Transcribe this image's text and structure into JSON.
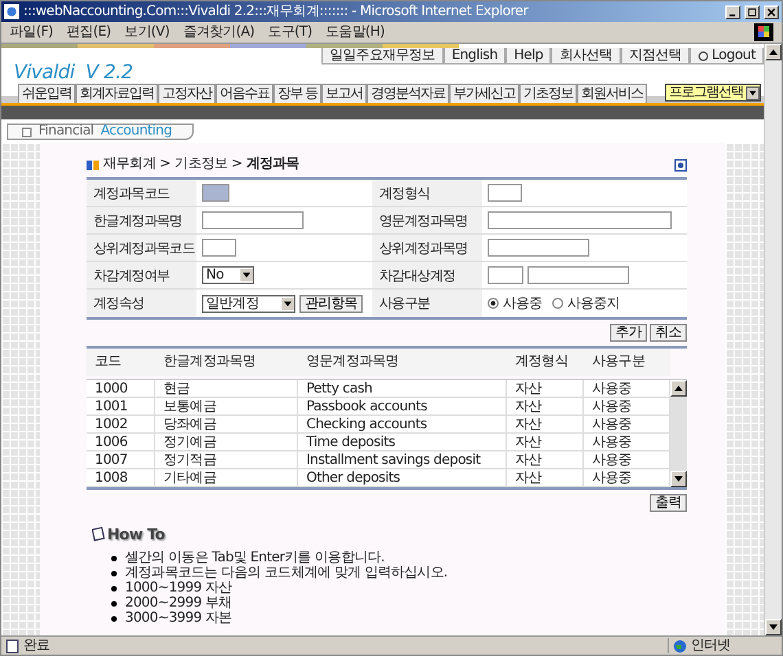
{
  "window": {
    "title": ":::webNaccounting.Com:::Vivaldi 2.2:::재무회계::::::: - Microsoft Internet Explorer"
  },
  "menu": [
    "파일(F)",
    "편집(E)",
    "보기(V)",
    "즐겨찾기(A)",
    "도구(T)",
    "도움말(H)"
  ],
  "top_links": [
    "일일주요재무정보",
    "English",
    "Help",
    "회사선택",
    "지점선택",
    "Logout"
  ],
  "logo": "Vivaldi  V 2.2",
  "nav_tabs": [
    "쉬운입력",
    "회계자료입력",
    "고정자산",
    "어음수표",
    "장부 등",
    "보고서",
    "경영분석자료",
    "부가세신고",
    "기초정보",
    "회원서비스"
  ],
  "program_select": "프로그램선택",
  "section_tab": {
    "word_1": "Financial",
    "word_2": "Accounting"
  },
  "breadcrumb": [
    "재무회계 >",
    "기초정보 >",
    "계정과목"
  ],
  "form": [
    {
      "left": {
        "label": "계정과목코드",
        "kind": "code"
      },
      "right": {
        "label": "계정형식",
        "kind": "small"
      }
    },
    {
      "left": {
        "label": "한글계정과목명",
        "kind": "medium"
      },
      "right": {
        "label": "영문계정과목명",
        "kind": "large"
      }
    },
    {
      "left": {
        "label": "상위계정과목코드",
        "kind": "small"
      },
      "right": {
        "label": "상위계정과목명",
        "kind": "medium"
      }
    },
    {
      "left": {
        "label": "차감계정여부",
        "kind": "select",
        "value": "No"
      },
      "right": {
        "label": "차감대상계정",
        "kind": "pair"
      }
    },
    {
      "left": {
        "label": "계정속성",
        "kind": "select_button",
        "value": "일반계정",
        "button": "관리항목"
      },
      "right": {
        "label": "사용구분",
        "kind": "radio",
        "options": [
          {
            "label": "사용중",
            "selected": true
          },
          {
            "label": "사용중지",
            "selected": false
          }
        ]
      }
    }
  ],
  "form_buttons": [
    "추가",
    "취소"
  ],
  "table": {
    "columns": [
      "코드",
      "한글계정과목명",
      "영문계정과목명",
      "계정형식",
      "사용구분"
    ],
    "rows": [
      [
        "1000",
        "현금",
        "Petty cash",
        "자산",
        "사용중"
      ],
      [
        "1001",
        "보통예금",
        "Passbook accounts",
        "자산",
        "사용중"
      ],
      [
        "1002",
        "당좌예금",
        "Checking accounts",
        "자산",
        "사용중"
      ],
      [
        "1006",
        "정기예금",
        "Time deposits",
        "자산",
        "사용중"
      ],
      [
        "1007",
        "정기적금",
        "Installment savings deposit",
        "자산",
        "사용중"
      ],
      [
        "1008",
        "기타예금",
        "Other deposits",
        "자산",
        "사용중"
      ]
    ]
  },
  "print_button": "출력",
  "how_to": {
    "title": "How To",
    "items": [
      "셀간의 이동은 Tab및 Enter키를 이용합니다.",
      "계정과목코드는 다음의 코드체계에 맞게 입력하십시오.",
      "1000~1999 자산",
      "2000~2999 부채",
      "3000~3999 자본"
    ]
  },
  "status_bar": {
    "text": "완료",
    "zone": "인터넷"
  }
}
